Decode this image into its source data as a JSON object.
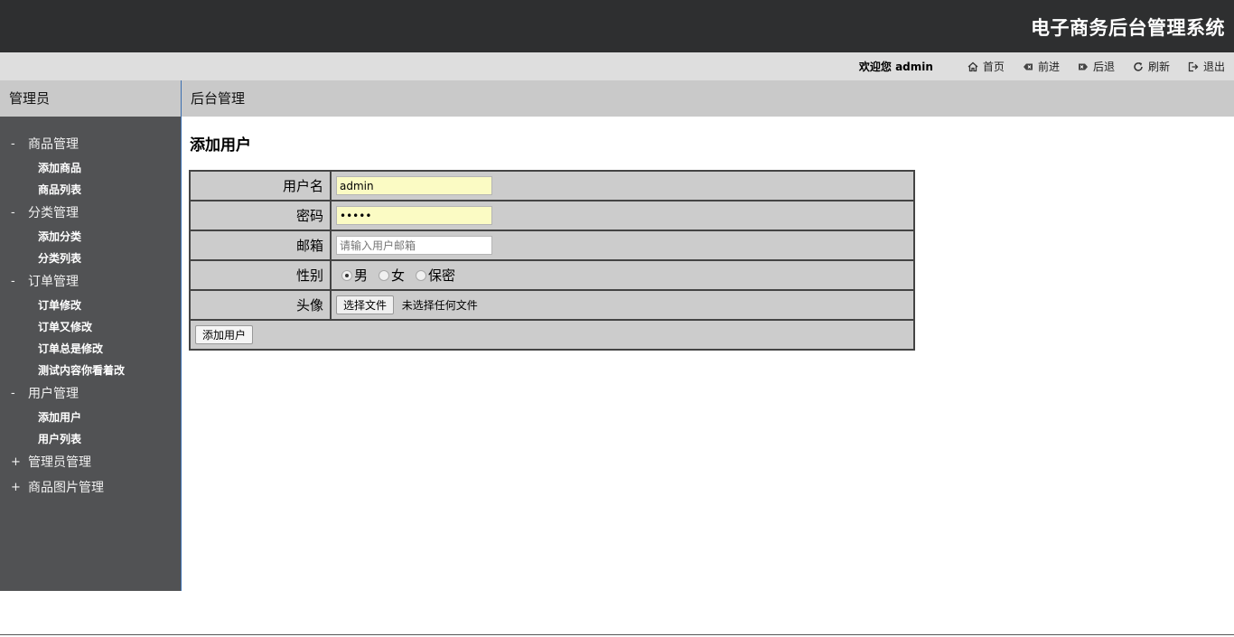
{
  "header": {
    "title": "电子商务后台管理系统"
  },
  "toolbar": {
    "welcome": "欢迎您 admin",
    "links": [
      {
        "label": "首页",
        "icon": "home-icon"
      },
      {
        "label": "前进",
        "icon": "forward-icon"
      },
      {
        "label": "后退",
        "icon": "back-icon"
      },
      {
        "label": "刷新",
        "icon": "refresh-icon"
      },
      {
        "label": "退出",
        "icon": "logout-icon"
      }
    ]
  },
  "sidebar": {
    "title": "管理员",
    "groups": [
      {
        "sign": "-",
        "label": "商品管理",
        "items": [
          "添加商品",
          "商品列表"
        ]
      },
      {
        "sign": "-",
        "label": "分类管理",
        "items": [
          "添加分类",
          "分类列表"
        ]
      },
      {
        "sign": "-",
        "label": "订单管理",
        "items": [
          "订单修改",
          "订单又修改",
          "订单总是修改",
          "测试内容你看着改"
        ]
      },
      {
        "sign": "-",
        "label": "用户管理",
        "items": [
          "添加用户",
          "用户列表"
        ]
      },
      {
        "sign": "+",
        "label": "管理员管理",
        "items": []
      },
      {
        "sign": "+",
        "label": "商品图片管理",
        "items": []
      }
    ]
  },
  "main": {
    "header": "后台管理",
    "page_title": "添加用户",
    "form": {
      "username_label": "用户名",
      "username_value": "admin",
      "password_label": "密码",
      "password_value": "•••••",
      "email_label": "邮箱",
      "email_placeholder": "请输入用户邮箱",
      "gender_label": "性别",
      "gender_options": [
        "男",
        "女",
        "保密"
      ],
      "gender_selected": "男",
      "avatar_label": "头像",
      "file_button": "选择文件",
      "file_status": "未选择任何文件",
      "submit_label": "添加用户"
    }
  }
}
